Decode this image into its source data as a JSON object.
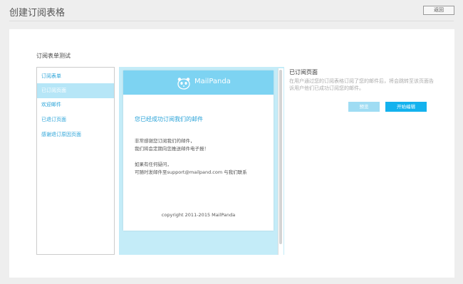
{
  "header": {
    "title": "创建订阅表格",
    "back_label": "返回"
  },
  "form": {
    "name": "订阅表单测试"
  },
  "sidebar": {
    "items": [
      {
        "label": "订阅表单"
      },
      {
        "label": "已订阅页面"
      },
      {
        "label": "欢迎邮件"
      },
      {
        "label": "已退订页面"
      },
      {
        "label": "感谢退订原因页面"
      }
    ]
  },
  "email": {
    "brand": "MailPanda",
    "heading": "您已经成功订阅我们的邮件",
    "body_lines": [
      "非常感谢您订阅我们的邮件，",
      "我们将会定期向您推送邮件电子报！",
      "如果有任何疑问，",
      "可随时发邮件至support@mailpand.com 与我们联系"
    ],
    "copyright": "copyright 2011-2015 MailPanda"
  },
  "info": {
    "title": "已订阅页面",
    "description": "在用户通过您的订阅表格订阅了您的邮件后，将会跳转至该页面告诉用户他们已成功订阅您的邮件。",
    "preview_label": "预览",
    "edit_label": "开始编辑"
  },
  "colors": {
    "accent": "#14b2ee",
    "header_bar": "#7dd3f2",
    "active_item": "#b6e6f7",
    "preview_bg": "#c4ecf8",
    "link_text": "#2aa3d8"
  }
}
